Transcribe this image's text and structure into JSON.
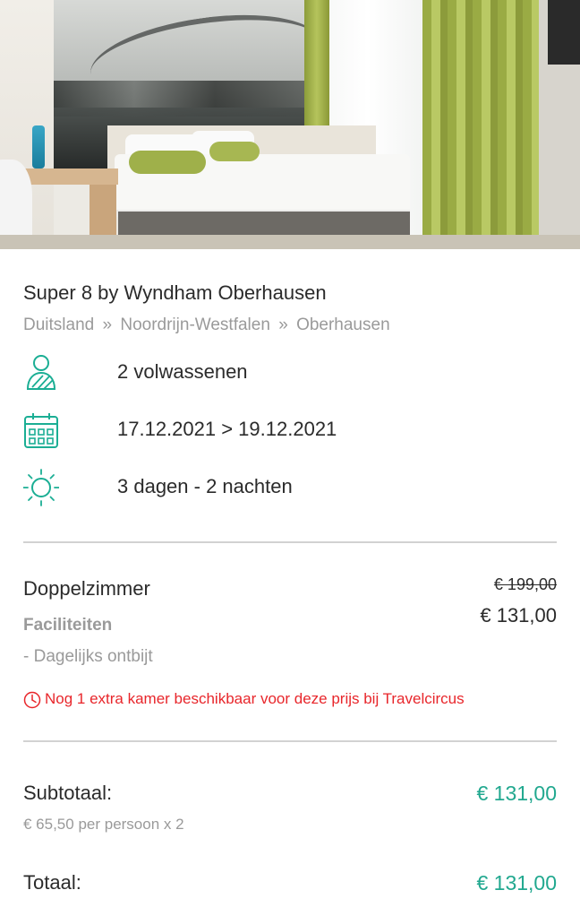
{
  "colors": {
    "accent": "#21a88f",
    "icon_teal": "#1bae94",
    "alert_red": "#e8262b",
    "muted_text": "#9a9a9a",
    "divider": "#d2d2d2"
  },
  "hotel": {
    "name": "Super 8 by Wyndham Oberhausen",
    "breadcrumb": [
      "Duitsland",
      "Noordrijn-Westfalen",
      "Oberhausen"
    ],
    "breadcrumb_separator": "»"
  },
  "details": {
    "guests": {
      "icon": "person-icon",
      "text": "2 volwassenen"
    },
    "dates": {
      "icon": "calendar-icon",
      "text": "17.12.2021 > 19.12.2021"
    },
    "duration": {
      "icon": "sun-icon",
      "text": "3 dagen - 2 nachten"
    }
  },
  "room": {
    "name": "Doppelzimmer",
    "old_price": "€ 199,00",
    "price": "€ 131,00",
    "facilities_label": "Faciliteiten",
    "facilities": [
      "- Dagelijks ontbijt"
    ],
    "availability_icon": "clock-icon",
    "availability_notice": "Nog 1 extra kamer beschikbaar voor deze prijs bij Travelcircus"
  },
  "summary": {
    "subtotal_label": "Subtotaal:",
    "subtotal_value": "€ 131,00",
    "per_person": "€ 65,50 per persoon x 2",
    "total_label": "Totaal:",
    "total_value": "€ 131,00"
  }
}
